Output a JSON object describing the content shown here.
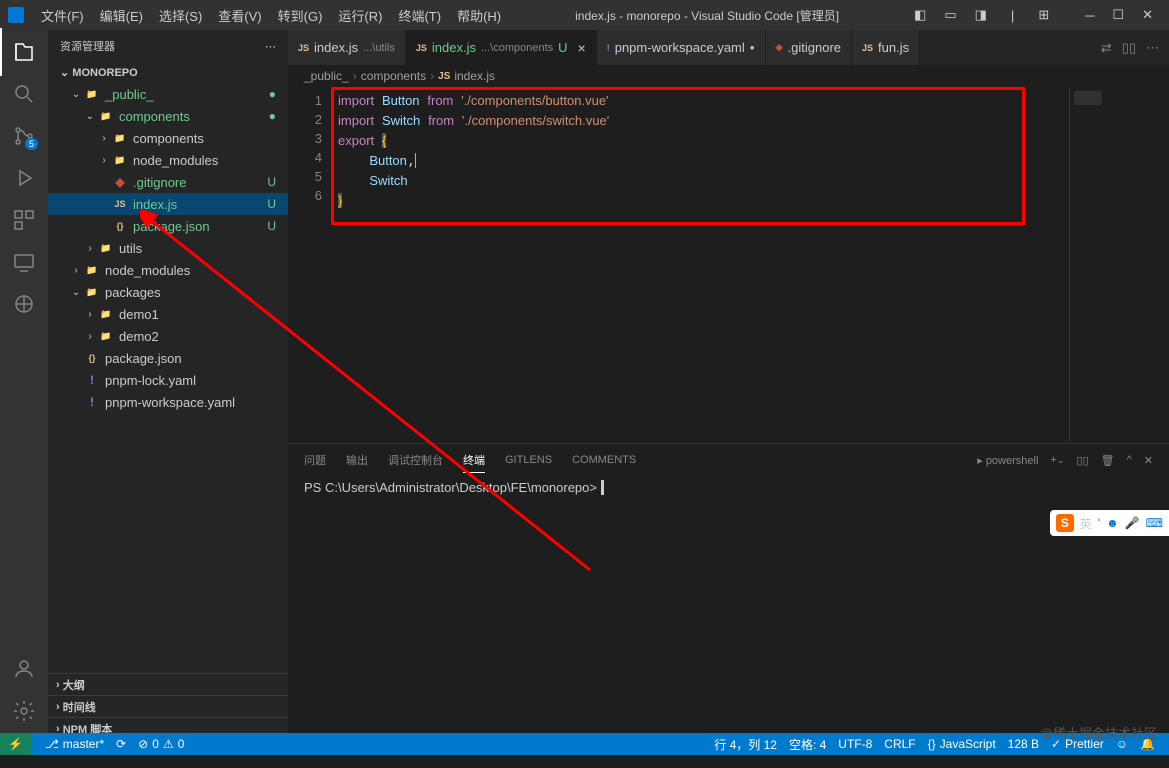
{
  "titlebar": {
    "menus": [
      "文件(F)",
      "编辑(E)",
      "选择(S)",
      "查看(V)",
      "转到(G)",
      "运行(R)",
      "终端(T)",
      "帮助(H)"
    ],
    "title": "index.js - monorepo - Visual Studio Code [管理员]"
  },
  "activity": {
    "scm_badge": "5"
  },
  "sidebar": {
    "title": "资源管理器",
    "project": "MONOREPO",
    "sections": {
      "outline": "大纲",
      "timeline": "时间线",
      "npm": "NPM 脚本"
    }
  },
  "tree": [
    {
      "pad": 8,
      "chev": "⌄",
      "icon": "📁",
      "name": "_public_",
      "cls": "fgreen",
      "status": "●"
    },
    {
      "pad": 22,
      "chev": "⌄",
      "icon": "📁",
      "name": "components",
      "cls": "fgreen",
      "status": "●"
    },
    {
      "pad": 36,
      "chev": "›",
      "icon": "📁",
      "name": "components",
      "cls": "",
      "status": ""
    },
    {
      "pad": 36,
      "chev": "›",
      "icon": "📁",
      "name": "node_modules",
      "cls": "",
      "status": ""
    },
    {
      "pad": 36,
      "chev": "",
      "icon": "◆",
      "name": ".gitignore",
      "cls": "fgreen",
      "status": "U",
      "iconcls": "fred"
    },
    {
      "pad": 36,
      "chev": "",
      "icon": "JS",
      "name": "index.js",
      "cls": "fgreen",
      "status": "U",
      "iconcls": "fyellow",
      "sel": true
    },
    {
      "pad": 36,
      "chev": "",
      "icon": "{}",
      "name": "package.json",
      "cls": "fgreen",
      "status": "U",
      "iconcls": "fyellow"
    },
    {
      "pad": 22,
      "chev": "›",
      "icon": "📁",
      "name": "utils",
      "cls": "",
      "status": ""
    },
    {
      "pad": 8,
      "chev": "›",
      "icon": "📁",
      "name": "node_modules",
      "cls": "",
      "status": ""
    },
    {
      "pad": 8,
      "chev": "⌄",
      "icon": "📁",
      "name": "packages",
      "cls": "",
      "status": ""
    },
    {
      "pad": 22,
      "chev": "›",
      "icon": "📁",
      "name": "demo1",
      "cls": "",
      "status": ""
    },
    {
      "pad": 22,
      "chev": "›",
      "icon": "📁",
      "name": "demo2",
      "cls": "",
      "status": ""
    },
    {
      "pad": 8,
      "chev": "",
      "icon": "{}",
      "name": "package.json",
      "cls": "",
      "status": "",
      "iconcls": "fyellow"
    },
    {
      "pad": 8,
      "chev": "",
      "icon": "!",
      "name": "pnpm-lock.yaml",
      "cls": "",
      "status": "",
      "iconcls": "fpurple"
    },
    {
      "pad": 8,
      "chev": "",
      "icon": "!",
      "name": "pnpm-workspace.yaml",
      "cls": "",
      "status": "",
      "iconcls": "fpurple"
    }
  ],
  "tabs": [
    {
      "icon": "JS",
      "label": "index.js",
      "sub": "...\\utils",
      "iconcls": "fyellow"
    },
    {
      "icon": "JS",
      "label": "index.js",
      "sub": "...\\components",
      "status": "U",
      "iconcls": "fyellow",
      "active": true,
      "cls": "fgreen"
    },
    {
      "icon": "!",
      "label": "pnpm-workspace.yaml",
      "iconcls": "fpurple",
      "dot": true
    },
    {
      "icon": "◆",
      "label": ".gitignore",
      "iconcls": "fred"
    },
    {
      "icon": "JS",
      "label": "fun.js",
      "iconcls": "fyellow"
    }
  ],
  "breadcrumb": [
    "_public_",
    "components",
    "index.js"
  ],
  "breadcrumb_icon": "JS",
  "code": {
    "lines": [
      "1",
      "2",
      "3",
      "4",
      "5",
      "6"
    ]
  },
  "panel": {
    "tabs": [
      "问题",
      "输出",
      "调试控制台",
      "终端",
      "GITLENS",
      "COMMENTS"
    ],
    "active": "终端",
    "shell": "powershell",
    "prompt": "PS C:\\Users\\Administrator\\Desktop\\FE\\monorepo> "
  },
  "status": {
    "branch": "master*",
    "sync": "⟳",
    "errors": "0",
    "warnings": "0",
    "line": "行 4，列 12",
    "spaces": "空格: 4",
    "encoding": "UTF-8",
    "eol": "CRLF",
    "lang": "JavaScript",
    "size": "128 B",
    "prettier": "Prettier"
  },
  "sogou": {
    "label": "英"
  },
  "watermark": "@稀土掘金技术社区"
}
